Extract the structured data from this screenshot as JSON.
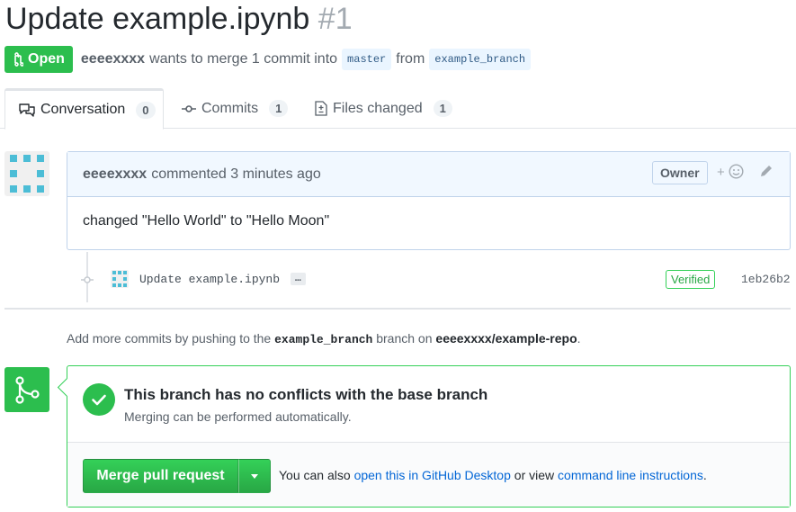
{
  "pr": {
    "title": "Update example.ipynb",
    "number": "#1",
    "state": "Open",
    "author": "eeeexxxx",
    "summary": "wants to merge 1 commit into",
    "base_branch": "master",
    "from_text": "from",
    "head_branch": "example_branch"
  },
  "tabs": [
    {
      "label": "Conversation",
      "count": "0",
      "icon": "comment-discussion-icon"
    },
    {
      "label": "Commits",
      "count": "1",
      "icon": "git-commit-icon"
    },
    {
      "label": "Files changed",
      "count": "1",
      "icon": "file-diff-icon"
    }
  ],
  "comment": {
    "author": "eeeexxxx",
    "action": "commented 3 minutes ago",
    "role": "Owner",
    "reaction_label": "+",
    "body": "changed \"Hello World\" to \"Hello Moon\""
  },
  "commit": {
    "message": "Update example.ipynb",
    "ellipsis": "…",
    "verified": "Verified",
    "sha": "1eb26b2"
  },
  "hint": {
    "prefix": "Add more commits by pushing to the",
    "branch": "example_branch",
    "middle": "branch on",
    "repo": "eeeexxxx/example-repo",
    "suffix": "."
  },
  "merge": {
    "status_title": "This branch has no conflicts with the base branch",
    "status_sub": "Merging can be performed automatically.",
    "button_label": "Merge pull request",
    "alt_prefix": "You can also",
    "alt_link1": "open this in GitHub Desktop",
    "alt_middle": "or view",
    "alt_link2": "command line instructions",
    "alt_suffix": "."
  },
  "colors": {
    "green": "#2cbe4e",
    "link": "#0366d6",
    "comment_header_bg": "#f1f8ff",
    "avatar_teal": "#4cbdd6"
  }
}
